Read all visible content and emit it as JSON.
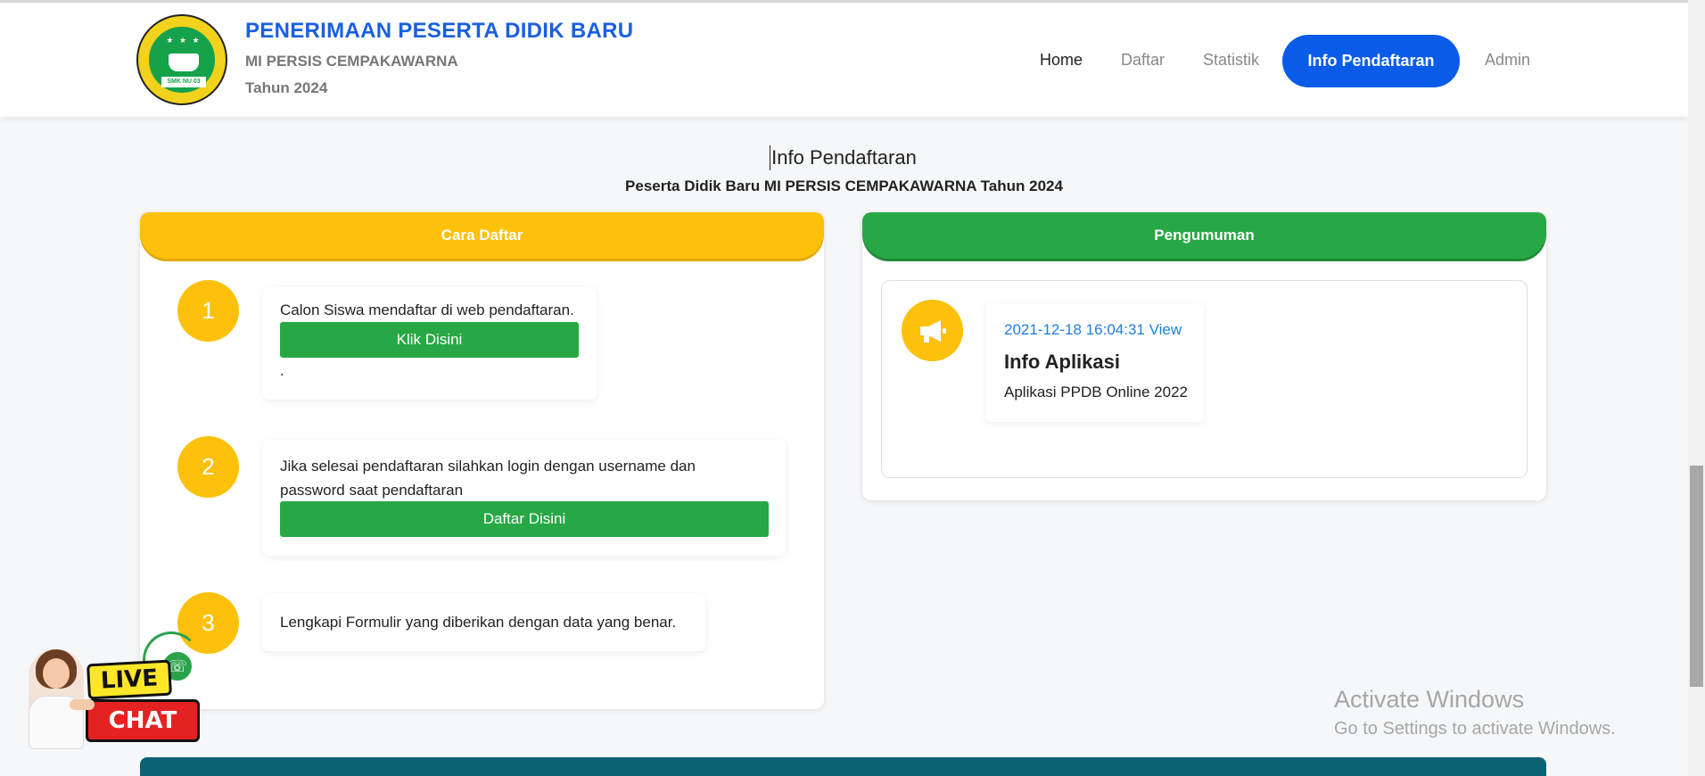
{
  "header": {
    "title": "PENERIMAAN PESERTA DIDIK BARU",
    "school": "MI PERSIS CEMPAKAWARNA",
    "year": "Tahun 2024",
    "logo_text": "SMK NU 03"
  },
  "nav": {
    "home": "Home",
    "daftar": "Daftar",
    "statistik": "Statistik",
    "info": "Info Pendaftaran",
    "admin": "Admin"
  },
  "page": {
    "title": "Info Pendaftaran",
    "subtitle": "Peserta Didik Baru MI PERSIS CEMPAKAWARNA Tahun 2024"
  },
  "cara_daftar": {
    "header": "Cara Daftar",
    "steps": [
      {
        "num": "1",
        "text": "Calon Siswa mendaftar di web pendaftaran.",
        "button": "Klik Disini",
        "after": "."
      },
      {
        "num": "2",
        "text": "Jika selesai pendaftaran silahkan login dengan username dan password saat pendaftaran",
        "button": "Daftar Disini"
      },
      {
        "num": "3",
        "text": "Lengkapi Formulir yang diberikan dengan data yang benar."
      }
    ]
  },
  "pengumuman": {
    "header": "Pengumuman",
    "item": {
      "date": "2021-12-18 16:04:31 View",
      "title": "Info Aplikasi",
      "desc": "Aplikasi PPDB Online 2022"
    }
  },
  "watermark": {
    "title": "Activate Windows",
    "subtitle": "Go to Settings to activate Windows."
  },
  "chat_widget": {
    "live": "LIVE",
    "chat": "CHAT"
  },
  "colors": {
    "primary": "#0a5ce8",
    "yellow": "#fdc10b",
    "green": "#27a844",
    "teal": "#0a6473"
  }
}
